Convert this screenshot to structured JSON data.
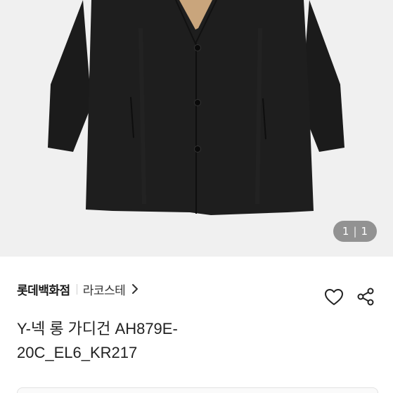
{
  "image": {
    "counter": {
      "current": "1",
      "separator": "|",
      "total": "1"
    }
  },
  "brand_row": {
    "store_name": "롯데백화점",
    "brand_name": "라코스테"
  },
  "product": {
    "title_line1": "Y-넥 롱 가디건 AH879E-",
    "title_line2": "20C_EL6_KR217"
  },
  "colors": {
    "background": "#f0f0f0",
    "coat": "#1c1c1c",
    "lining": "#c9a57c"
  },
  "icons": [
    "chevron-right-icon",
    "heart-icon",
    "share-icon"
  ]
}
